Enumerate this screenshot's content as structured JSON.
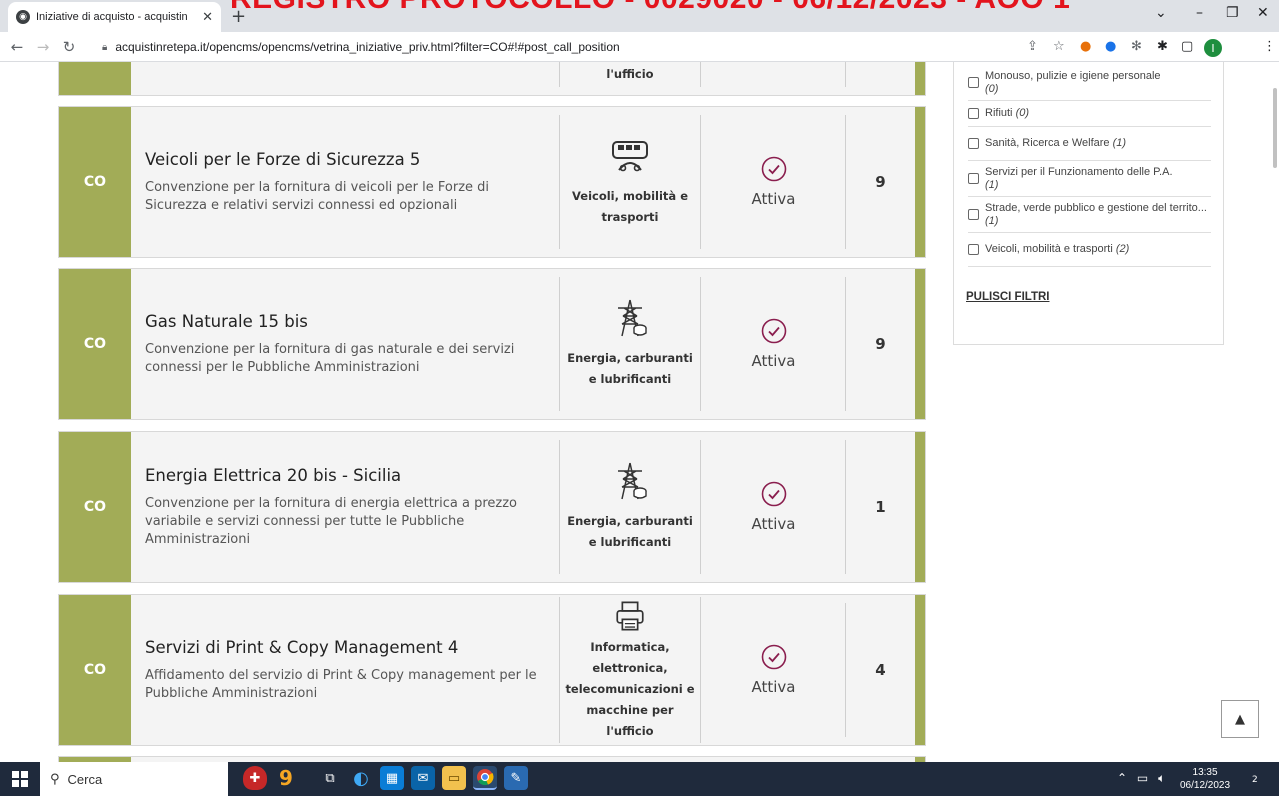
{
  "browser": {
    "tab_title": "Iniziative di acquisto - acquistin",
    "overlay_text": "REGISTRO PROTOCOLLO - 0029020 - 06/12/2023 - AOO 1",
    "url": "acquistinretepa.it/opencms/opencms/vetrina_iniziative_priv.html?filter=CO#!#post_call_position",
    "profile_initial": "I"
  },
  "top_partial": {
    "category_label": "macchine per l'ufficio"
  },
  "cards": [
    {
      "code": "CO",
      "title": "Veicoli per le Forze di Sicurezza 5",
      "description": "Convenzione per la fornitura di veicoli per le Forze di Sicurezza e relativi servizi connessi ed opzionali",
      "category": "Veicoli, mobilità e trasporti",
      "category_icon": "bus-icon",
      "status": "Attiva",
      "count": "9"
    },
    {
      "code": "CO",
      "title": "Gas Naturale 15 bis",
      "description": "Convenzione per la fornitura di gas naturale e dei servizi connessi per le Pubbliche Amministrazioni",
      "category": "Energia, carburanti e lubrificanti",
      "category_icon": "power-pylon-icon",
      "status": "Attiva",
      "count": "9"
    },
    {
      "code": "CO",
      "title": "Energia Elettrica 20 bis - Sicilia",
      "description": "Convenzione per la fornitura di energia elettrica a prezzo variabile e servizi connessi per tutte le Pubbliche Amministrazioni",
      "category": "Energia, carburanti e lubrificanti",
      "category_icon": "power-pylon-icon",
      "status": "Attiva",
      "count": "1"
    },
    {
      "code": "CO",
      "title": "Servizi di Print & Copy Management 4",
      "description": "Affidamento del servizio di Print & Copy management per le Pubbliche Amministrazioni",
      "category": "Informatica, elettronica, telecomunicazioni e macchine per l'ufficio",
      "category_icon": "printer-icon",
      "status": "Attiva",
      "count": "4"
    }
  ],
  "filters": {
    "items": [
      {
        "label": "Monouso, pulizie e igiene personale",
        "count": "(0)"
      },
      {
        "label": "Rifiuti",
        "count": "(0)"
      },
      {
        "label": "Sanità, Ricerca e Welfare",
        "count": "(1)"
      },
      {
        "label": "Servizi per il Funzionamento delle P.A.",
        "count": "(1)"
      },
      {
        "label": "Strade, verde pubblico e gestione del territo...",
        "count": "(1)"
      },
      {
        "label": "Veicoli, mobilità e trasporti",
        "count": "(2)"
      }
    ],
    "clear_label": "PULISCI FILTRI"
  },
  "taskbar": {
    "search_label": "Cerca",
    "time": "13:35",
    "date": "06/12/2023",
    "notification_count": "2"
  },
  "colors": {
    "accent_green": "#a2ac57",
    "overlay_red": "#e3141d",
    "check_purple": "#8a1e4e"
  }
}
